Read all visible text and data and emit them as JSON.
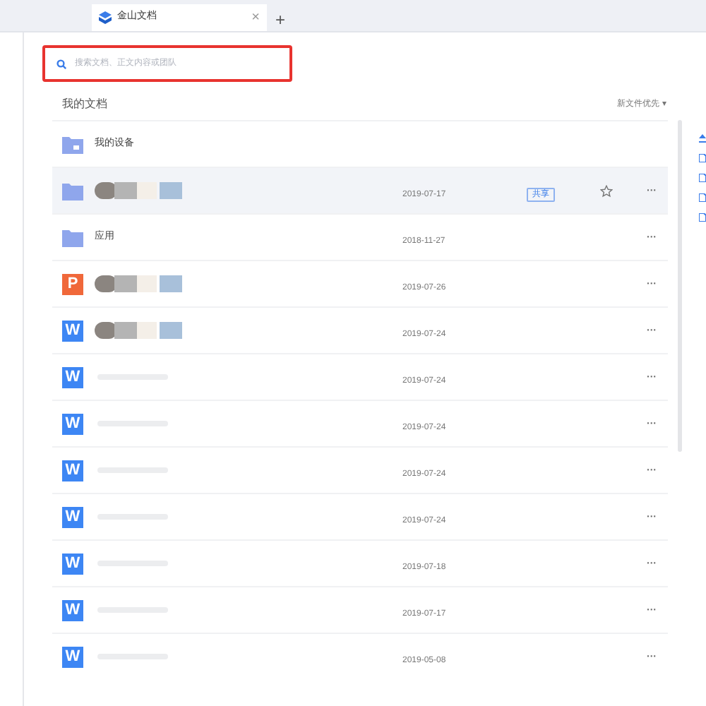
{
  "browser_tab": {
    "title": "金山文档",
    "close": "×",
    "new_tab": "+"
  },
  "search": {
    "placeholder": "搜索文档、正文内容或团队",
    "highlighted": true
  },
  "section_title": "我的文档",
  "sort": {
    "label": "新文件优先",
    "caret": "▾"
  },
  "rows": [
    {
      "kind": "device",
      "name": "我的设备",
      "selected": false
    },
    {
      "kind": "folder",
      "blurred_name": true,
      "date": "2019-07-17",
      "badge": "共享",
      "starrable": true,
      "menu": "···",
      "selected": true
    },
    {
      "kind": "folder",
      "name": "应用",
      "date": "2018-11-27",
      "menu": "···",
      "selected": false
    },
    {
      "kind": "ppt",
      "letter": "P",
      "blurred_name": true,
      "date": "2019-07-26",
      "menu": "···",
      "selected": false
    },
    {
      "kind": "doc",
      "letter": "W",
      "blurred_name": true,
      "date": "2019-07-24",
      "menu": "···",
      "selected": false
    },
    {
      "kind": "doc",
      "letter": "W",
      "blurred_name": true,
      "faint": true,
      "date": "2019-07-24",
      "menu": "···",
      "selected": false
    },
    {
      "kind": "doc",
      "letter": "W",
      "blurred_name": true,
      "faint": true,
      "date": "2019-07-24",
      "menu": "···",
      "selected": false
    },
    {
      "kind": "doc",
      "letter": "W",
      "blurred_name": true,
      "faint": true,
      "date": "2019-07-24",
      "menu": "···",
      "selected": false
    },
    {
      "kind": "doc",
      "letter": "W",
      "blurred_name": true,
      "faint": true,
      "date": "2019-07-24",
      "menu": "···",
      "selected": false
    },
    {
      "kind": "doc",
      "letter": "W",
      "blurred_name": true,
      "faint": true,
      "date": "2019-07-18",
      "menu": "···",
      "selected": false
    },
    {
      "kind": "doc",
      "letter": "W",
      "blurred_name": true,
      "faint": true,
      "date": "2019-07-17",
      "menu": "···",
      "selected": false
    },
    {
      "kind": "doc",
      "letter": "W",
      "blurred_name": true,
      "faint": true,
      "date": "2019-05-08",
      "menu": "···",
      "selected": false
    }
  ]
}
